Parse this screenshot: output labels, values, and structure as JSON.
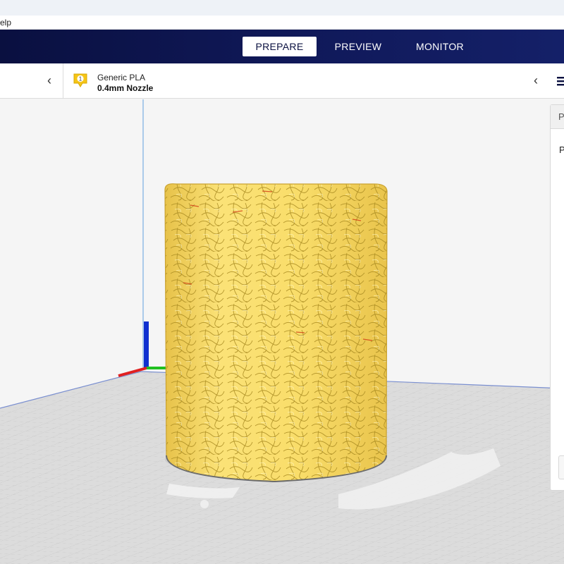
{
  "menubar": {
    "help_label": "elp"
  },
  "stages": {
    "prepare": "PREPARE",
    "preview": "PREVIEW",
    "monitor": "MONITOR"
  },
  "toolbar": {
    "extruder_number": "1",
    "material": "Generic PLA",
    "nozzle": "0.4mm Nozzle",
    "left_chevron": "‹",
    "right_chevron": "‹"
  },
  "side_panel": {
    "tab_label": "P",
    "heading": "P"
  },
  "colors": {
    "header": "#10195a",
    "model": "#f9dd6a",
    "extruder_badge": "#f5c518",
    "axis_x": "#e02020",
    "axis_y": "#20c020",
    "axis_z": "#1030d0",
    "build_plate": "#dedede"
  },
  "icons": {
    "extruder": "extruder-badge-icon",
    "settings": "print-settings-icon",
    "collapse": "chevron-left-icon"
  }
}
